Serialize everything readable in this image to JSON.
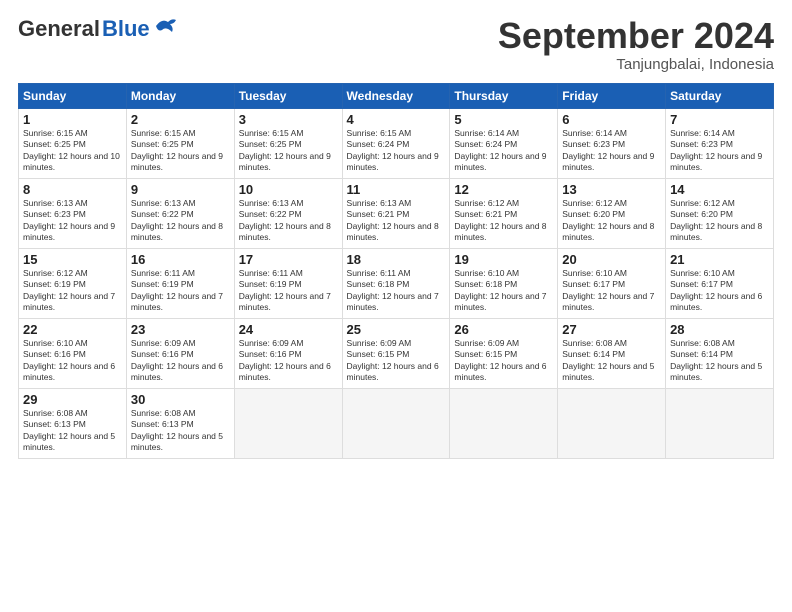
{
  "header": {
    "logo_general": "General",
    "logo_blue": "Blue",
    "month_year": "September 2024",
    "location": "Tanjungbalai, Indonesia"
  },
  "weekdays": [
    "Sunday",
    "Monday",
    "Tuesday",
    "Wednesday",
    "Thursday",
    "Friday",
    "Saturday"
  ],
  "weeks": [
    [
      {
        "day": "1",
        "sunrise": "6:15 AM",
        "sunset": "6:25 PM",
        "daylight": "12 hours and 10 minutes."
      },
      {
        "day": "2",
        "sunrise": "6:15 AM",
        "sunset": "6:25 PM",
        "daylight": "12 hours and 9 minutes."
      },
      {
        "day": "3",
        "sunrise": "6:15 AM",
        "sunset": "6:25 PM",
        "daylight": "12 hours and 9 minutes."
      },
      {
        "day": "4",
        "sunrise": "6:15 AM",
        "sunset": "6:24 PM",
        "daylight": "12 hours and 9 minutes."
      },
      {
        "day": "5",
        "sunrise": "6:14 AM",
        "sunset": "6:24 PM",
        "daylight": "12 hours and 9 minutes."
      },
      {
        "day": "6",
        "sunrise": "6:14 AM",
        "sunset": "6:23 PM",
        "daylight": "12 hours and 9 minutes."
      },
      {
        "day": "7",
        "sunrise": "6:14 AM",
        "sunset": "6:23 PM",
        "daylight": "12 hours and 9 minutes."
      }
    ],
    [
      {
        "day": "8",
        "sunrise": "6:13 AM",
        "sunset": "6:23 PM",
        "daylight": "12 hours and 9 minutes."
      },
      {
        "day": "9",
        "sunrise": "6:13 AM",
        "sunset": "6:22 PM",
        "daylight": "12 hours and 8 minutes."
      },
      {
        "day": "10",
        "sunrise": "6:13 AM",
        "sunset": "6:22 PM",
        "daylight": "12 hours and 8 minutes."
      },
      {
        "day": "11",
        "sunrise": "6:13 AM",
        "sunset": "6:21 PM",
        "daylight": "12 hours and 8 minutes."
      },
      {
        "day": "12",
        "sunrise": "6:12 AM",
        "sunset": "6:21 PM",
        "daylight": "12 hours and 8 minutes."
      },
      {
        "day": "13",
        "sunrise": "6:12 AM",
        "sunset": "6:20 PM",
        "daylight": "12 hours and 8 minutes."
      },
      {
        "day": "14",
        "sunrise": "6:12 AM",
        "sunset": "6:20 PM",
        "daylight": "12 hours and 8 minutes."
      }
    ],
    [
      {
        "day": "15",
        "sunrise": "6:12 AM",
        "sunset": "6:19 PM",
        "daylight": "12 hours and 7 minutes."
      },
      {
        "day": "16",
        "sunrise": "6:11 AM",
        "sunset": "6:19 PM",
        "daylight": "12 hours and 7 minutes."
      },
      {
        "day": "17",
        "sunrise": "6:11 AM",
        "sunset": "6:19 PM",
        "daylight": "12 hours and 7 minutes."
      },
      {
        "day": "18",
        "sunrise": "6:11 AM",
        "sunset": "6:18 PM",
        "daylight": "12 hours and 7 minutes."
      },
      {
        "day": "19",
        "sunrise": "6:10 AM",
        "sunset": "6:18 PM",
        "daylight": "12 hours and 7 minutes."
      },
      {
        "day": "20",
        "sunrise": "6:10 AM",
        "sunset": "6:17 PM",
        "daylight": "12 hours and 7 minutes."
      },
      {
        "day": "21",
        "sunrise": "6:10 AM",
        "sunset": "6:17 PM",
        "daylight": "12 hours and 6 minutes."
      }
    ],
    [
      {
        "day": "22",
        "sunrise": "6:10 AM",
        "sunset": "6:16 PM",
        "daylight": "12 hours and 6 minutes."
      },
      {
        "day": "23",
        "sunrise": "6:09 AM",
        "sunset": "6:16 PM",
        "daylight": "12 hours and 6 minutes."
      },
      {
        "day": "24",
        "sunrise": "6:09 AM",
        "sunset": "6:16 PM",
        "daylight": "12 hours and 6 minutes."
      },
      {
        "day": "25",
        "sunrise": "6:09 AM",
        "sunset": "6:15 PM",
        "daylight": "12 hours and 6 minutes."
      },
      {
        "day": "26",
        "sunrise": "6:09 AM",
        "sunset": "6:15 PM",
        "daylight": "12 hours and 6 minutes."
      },
      {
        "day": "27",
        "sunrise": "6:08 AM",
        "sunset": "6:14 PM",
        "daylight": "12 hours and 5 minutes."
      },
      {
        "day": "28",
        "sunrise": "6:08 AM",
        "sunset": "6:14 PM",
        "daylight": "12 hours and 5 minutes."
      }
    ],
    [
      {
        "day": "29",
        "sunrise": "6:08 AM",
        "sunset": "6:13 PM",
        "daylight": "12 hours and 5 minutes."
      },
      {
        "day": "30",
        "sunrise": "6:08 AM",
        "sunset": "6:13 PM",
        "daylight": "12 hours and 5 minutes."
      },
      null,
      null,
      null,
      null,
      null
    ]
  ]
}
